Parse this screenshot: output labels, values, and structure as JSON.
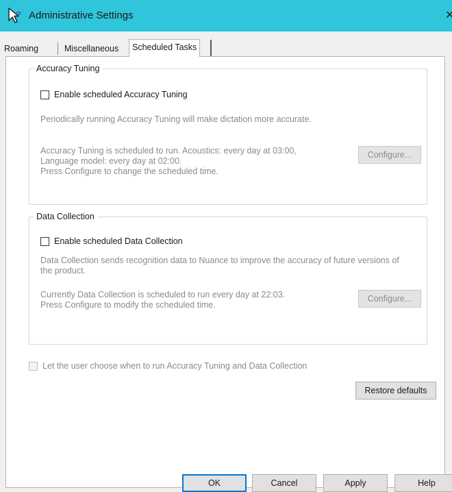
{
  "window": {
    "title": "Administrative Settings",
    "close_glyph": "✕"
  },
  "tabs": [
    {
      "label": "Roaming"
    },
    {
      "label": "Miscellaneous"
    },
    {
      "label": "Scheduled Tasks",
      "selected": true
    }
  ],
  "accuracy_tuning": {
    "group_label": "Accuracy Tuning",
    "checkbox_label": "Enable scheduled Accuracy Tuning",
    "checkbox_checked": false,
    "description": "Periodically running Accuracy Tuning will make dictation more accurate.",
    "schedule_line1": "Accuracy Tuning is scheduled to run. Acoustics: every day at 03:00,",
    "schedule_line2": "Language model: every day at 02:00.",
    "schedule_line3": "Press Configure to change the scheduled time.",
    "configure_label": "Configure..."
  },
  "data_collection": {
    "group_label": "Data Collection",
    "checkbox_label": "Enable scheduled Data Collection",
    "checkbox_checked": false,
    "description_line1": "Data Collection sends recognition data to Nuance to improve the accuracy of future versions of",
    "description_line2": "the product.",
    "schedule_line1": "Currently Data Collection is scheduled to run every day at 22:03.",
    "schedule_line2": "Press Configure to modify the scheduled time.",
    "configure_label": "Configure..."
  },
  "user_choose": {
    "checkbox_label": "Let the user choose when to run Accuracy Tuning and Data Collection",
    "checkbox_checked": false,
    "enabled": false
  },
  "restore_defaults_label": "Restore defaults",
  "dialog_buttons": {
    "ok": "OK",
    "cancel": "Cancel",
    "apply": "Apply",
    "help": "Help"
  },
  "colors": {
    "titlebar": "#2fc5da",
    "default_button_border": "#0078d7"
  },
  "icons": {
    "app": "speech-cursor-icon",
    "close": "close-icon"
  }
}
